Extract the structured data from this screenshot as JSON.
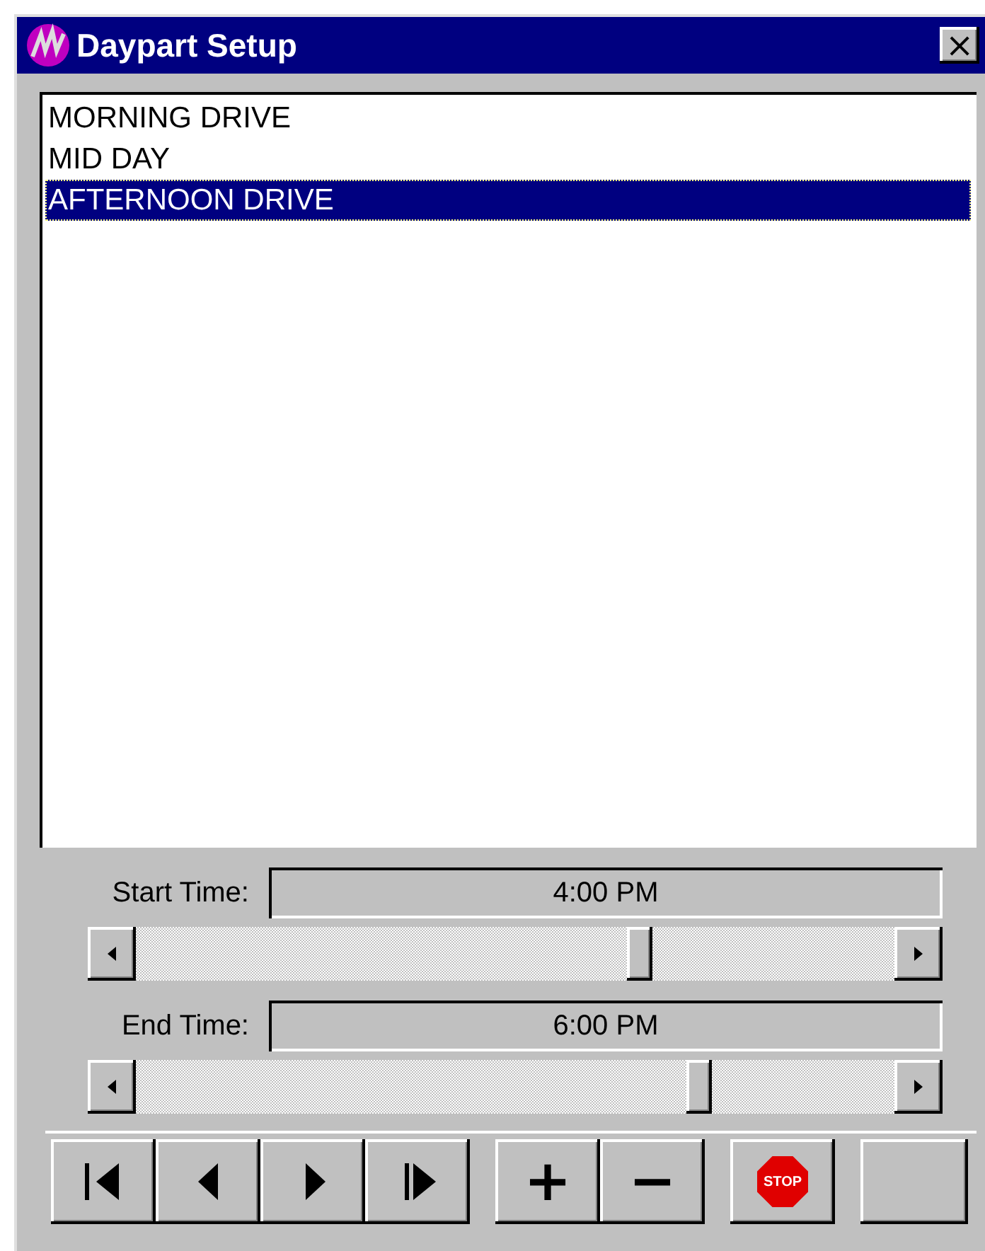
{
  "window": {
    "title": "Daypart Setup",
    "close": "×"
  },
  "dayparts": [
    {
      "label": "MORNING DRIVE",
      "selected": false
    },
    {
      "label": "MID DAY",
      "selected": false
    },
    {
      "label": "AFTERNOON DRIVE",
      "selected": true
    }
  ],
  "times": [
    {
      "label": "Start Time:",
      "value": "4:00 PM",
      "level": 0.67
    },
    {
      "label": "End Time:",
      "value": "6:00 PM",
      "level": 0.75
    }
  ],
  "toolbar": [
    {
      "kind": "first"
    },
    {
      "kind": "prev"
    },
    {
      "kind": "next"
    },
    {
      "kind": "last"
    },
    {
      "kind": "gap"
    },
    {
      "kind": "text",
      "label": "+"
    },
    {
      "kind": "text",
      "label": "−"
    },
    {
      "kind": "gap"
    },
    {
      "kind": "stop",
      "label": "STOP"
    },
    {
      "kind": "gap"
    },
    {
      "kind": "blank"
    }
  ]
}
